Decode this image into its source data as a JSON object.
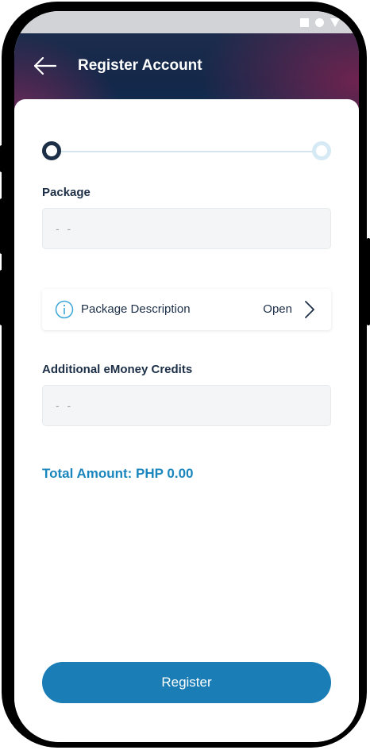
{
  "header": {
    "title": "Register Account",
    "back_icon": "arrow-left-icon"
  },
  "stepper": {
    "current_step": 1,
    "total_steps": 2
  },
  "form": {
    "package": {
      "label": "Package",
      "value": "",
      "placeholder": "- -"
    },
    "package_description": {
      "icon": "info-icon",
      "label": "Package Description",
      "action": "Open",
      "action_icon": "chevron-right-icon"
    },
    "credits": {
      "label": "Additional eMoney Credits",
      "value": "",
      "placeholder": "- -"
    }
  },
  "total": {
    "text": "Total Amount: PHP 0.00"
  },
  "actions": {
    "register_label": "Register"
  },
  "colors": {
    "primary": "#1a7db5",
    "dark": "#1c2f47",
    "accent_text": "#1a86bd"
  }
}
